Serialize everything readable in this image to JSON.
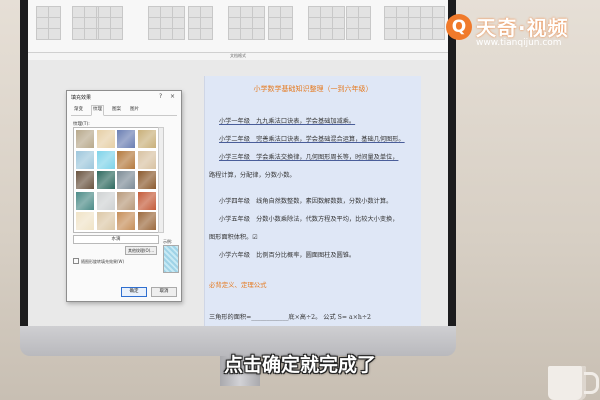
{
  "logo": {
    "mark": "Q",
    "name": "天奇·视频",
    "url": "www.tianqijun.com"
  },
  "document": {
    "title": "小学数学基础知识整理（一到六年级）",
    "lines": [
      "小学一年级　九九乘法口诀表，学会基础加减乘。",
      "小学二年级　完善乘法口诀表，学会基础混合运算，基础几何图形。",
      "小学三年级　学会乘法交换律，几何图形周长等，时间量及单位，",
      "路程计算，分配律，分数小数。",
      "小学四年级　线角自然数整数，素因数解数数，分数小数计算。",
      "小学五年级　分数小数乘除法，代数方程及平均，比较大小变换，",
      "图形面积体积。☑",
      "小学六年级　比例百分比概率，圆面图柱及圆锥。"
    ],
    "section_heading": "必背定义、定理公式",
    "formula": "三角形的面积=____________底×高÷2。 公式 S= a×h÷2"
  },
  "dialog": {
    "title": "填充效果",
    "help": "?",
    "close": "×",
    "tabs": [
      "渐变",
      "纹理",
      "图案",
      "图片"
    ],
    "active_tab": "纹理",
    "texture_label": "纹理(T):",
    "selected_texture": "水滴",
    "other_texture": "其他纹理(O)...",
    "rotate_with_shape": "随图形旋转填充效果(W)",
    "sample_label": "示例:",
    "ok": "确定",
    "cancel": "取消",
    "textures": [
      "#b8a98c",
      "#e6cfa6",
      "#6b7fb3",
      "#c9b07a",
      "#9ec7dc",
      "#7fd3e9",
      "#b47a3e",
      "#d8c2a2",
      "#6a5440",
      "#2f6a60",
      "#7d8c97",
      "#8b5a2e",
      "#4d8c88",
      "#cfd2d3",
      "#b89a7b",
      "#c45c3a",
      "#f0e3c7",
      "#dcc8a7",
      "#c68f5a",
      "#9c6a3e"
    ]
  },
  "subtitle": "点击确定就完成了"
}
